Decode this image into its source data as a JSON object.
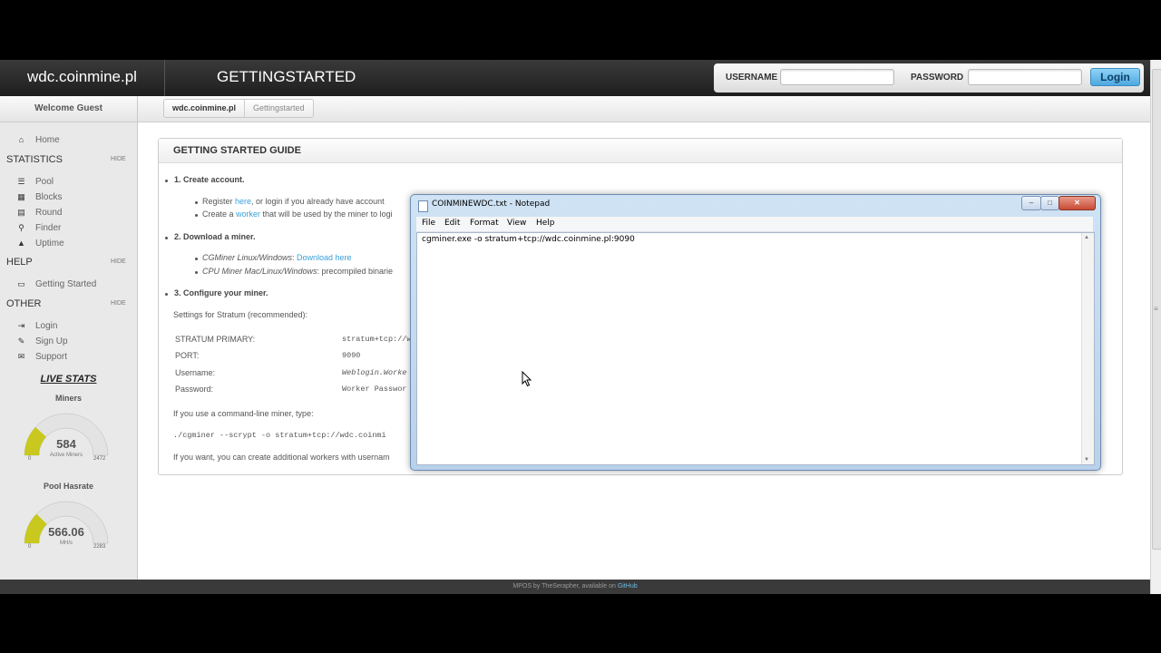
{
  "header": {
    "site_title": "wdc.coinmine.pl",
    "section_title": "GETTINGSTARTED",
    "username_label": "USERNAME",
    "password_label": "PASSWORD",
    "login_button": "Login"
  },
  "sidebar": {
    "welcome": "Welcome Guest",
    "home": "Home",
    "statistics_heading": "STATISTICS",
    "statistics_hide": "HIDE",
    "statistics_items": [
      "Pool",
      "Blocks",
      "Round",
      "Finder",
      "Uptime"
    ],
    "help_heading": "HELP",
    "help_hide": "HIDE",
    "help_items": [
      "Getting Started"
    ],
    "other_heading": "OTHER",
    "other_hide": "HIDE",
    "other_items": [
      "Login",
      "Sign Up",
      "Support"
    ],
    "live_stats": "LIVE STATS",
    "miners": {
      "title": "Miners",
      "value": "584",
      "unit": "Active Miners",
      "min": "0",
      "max": "2472"
    },
    "hashrate": {
      "title": "Pool Hasrate",
      "value": "566.06",
      "unit": "MH/s",
      "min": "0",
      "max": "2283"
    }
  },
  "breadcrumb": {
    "root": "wdc.coinmine.pl",
    "current": "Gettingstarted"
  },
  "guide": {
    "heading": "GETTING STARTED GUIDE",
    "step1": "1. Create account.",
    "step1_a_prefix": "Register ",
    "step1_a_link": "here",
    "step1_a_suffix": ", or login if you already have account",
    "step1_b_prefix": "Create a ",
    "step1_b_link": "worker",
    "step1_b_suffix": " that will be used by the miner to logi",
    "step2": "2. Download a miner.",
    "step2_a_name": "CGMiner Linux/Windows",
    "step2_a_link": "Download here",
    "step2_b_name": "CPU Miner Mac/Linux/Windows",
    "step2_b_suffix": ": precompiled binarie",
    "step3": "3. Configure your miner.",
    "settings_intro": "Settings for Stratum (recommended):",
    "settings": [
      {
        "key": "STRATUM PRIMARY:",
        "value": "stratum+tcp://w"
      },
      {
        "key": "PORT:",
        "value": "9090"
      },
      {
        "key": "Username:",
        "value": "Weblogin.Worke"
      },
      {
        "key": "Password:",
        "value": "Worker Passwor"
      }
    ],
    "cmdline_intro": "If you use a command-line miner, type:",
    "cmdline": "./cgminer --scrypt  -o stratum+tcp://wdc.coinmi",
    "additional": "If you want, you can create additional workers with usernam"
  },
  "notepad": {
    "title": "COINMINEWDC.txt - Notepad",
    "menu": [
      "File",
      "Edit",
      "Format",
      "View",
      "Help"
    ],
    "content": "cgminer.exe -o stratum+tcp://wdc.coinmine.pl:9090"
  },
  "footer": {
    "text": "MPOS by TheSerapher, available on ",
    "link": "GitHub"
  },
  "colors": {
    "accent": "#3aa0d8",
    "gauge_fill": "#c8c81e",
    "header_bg": "#2a2a2a"
  }
}
